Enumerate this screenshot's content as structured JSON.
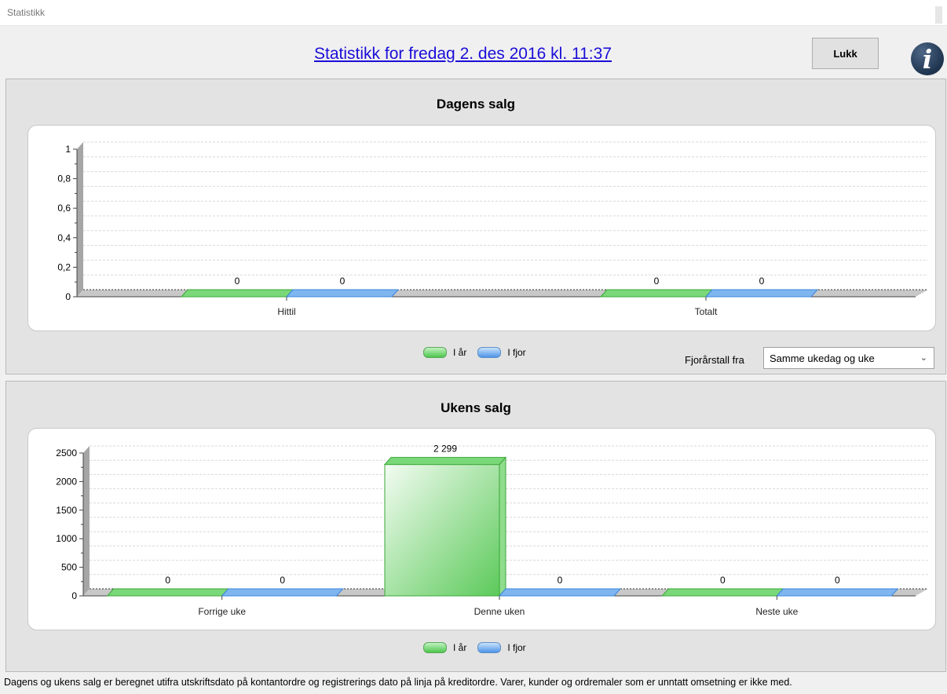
{
  "window": {
    "title": "Statistikk"
  },
  "header": {
    "link_text": "Statistikk for fredag 2. des 2016 kl. 11:37",
    "close_label": "Lukk",
    "info_icon": "info-icon",
    "info_glyph": "i"
  },
  "colors": {
    "this_year": "#4cc64b",
    "last_year": "#4d94e8",
    "link": "#1a0dd8",
    "panel_bg": "#e3e3e3"
  },
  "daily": {
    "title": "Dagens salg",
    "legend": [
      "I år",
      "I fjor"
    ],
    "prev_year_label": "Fjorårstall fra",
    "prev_year_value": "Samme ukedag og uke"
  },
  "weekly": {
    "title": "Ukens salg",
    "legend": [
      "I år",
      "I fjor"
    ]
  },
  "footnote": "Dagens og ukens salg er beregnet utifra utskriftsdato på kontantordre og registrerings dato på linja på kreditordre. Varer, kunder og ordremaler som er unntatt omsetning er ikke med.",
  "chart_data": [
    {
      "type": "bar",
      "title": "Dagens salg",
      "categories": [
        "Hittil",
        "Totalt"
      ],
      "series": [
        {
          "name": "I år",
          "values": [
            0,
            0
          ],
          "labels": [
            "0",
            "0"
          ]
        },
        {
          "name": "I fjor",
          "values": [
            0,
            0
          ],
          "labels": [
            "0",
            "0"
          ]
        }
      ],
      "ylim": [
        0,
        1
      ],
      "yticks": [
        "0",
        "0,2",
        "0,4",
        "0,6",
        "0,8",
        "1"
      ],
      "grid": true,
      "legend": "bottom"
    },
    {
      "type": "bar",
      "title": "Ukens salg",
      "categories": [
        "Forrige uke",
        "Denne uken",
        "Neste uke"
      ],
      "series": [
        {
          "name": "I år",
          "values": [
            0,
            2299,
            0
          ],
          "labels": [
            "0",
            "2 299",
            "0"
          ]
        },
        {
          "name": "I fjor",
          "values": [
            0,
            0,
            0
          ],
          "labels": [
            "0",
            "0",
            "0"
          ]
        }
      ],
      "ylim": [
        0,
        2500
      ],
      "yticks": [
        "0",
        "500",
        "1000",
        "1500",
        "2000",
        "2500"
      ],
      "grid": true,
      "legend": "bottom"
    }
  ]
}
